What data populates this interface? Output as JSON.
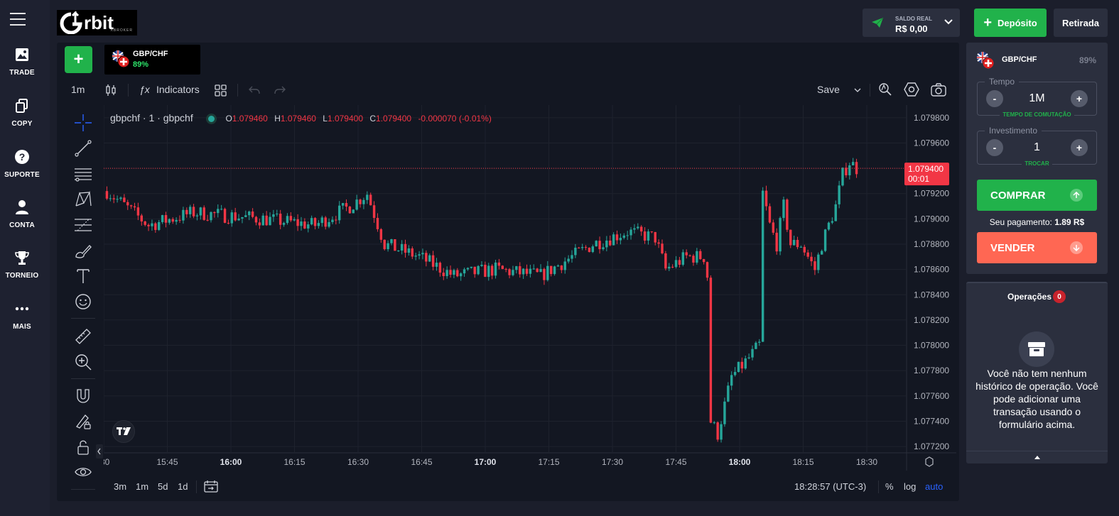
{
  "nav": {
    "items": [
      {
        "label": "TRADE",
        "icon": "image-icon"
      },
      {
        "label": "COPY",
        "icon": "copy-icon"
      },
      {
        "label": "SUPORTE",
        "icon": "help-icon"
      },
      {
        "label": "CONTA",
        "icon": "user-icon"
      },
      {
        "label": "TORNEIO",
        "icon": "trophy-icon"
      },
      {
        "label": "MAIS",
        "icon": "more-icon"
      }
    ]
  },
  "header": {
    "logo_text": "rbit",
    "logo_sub": "XBROKER",
    "balance_label": "SALDO REAL",
    "balance_value": "R$ 0,00",
    "deposit_label": "Depósito",
    "withdraw_label": "Retirada"
  },
  "asset_tab": {
    "name": "GBP/CHF",
    "payout": "89%"
  },
  "toolbar": {
    "interval": "1m",
    "indicators_label": "Indicators",
    "save_label": "Save"
  },
  "legend": {
    "symbol": "gbpchf · 1 · gbpchf",
    "open_label": "O",
    "open": "1.079460",
    "high_label": "H",
    "high": "1.079460",
    "low_label": "L",
    "low": "1.079400",
    "close_label": "C",
    "close": "1.079400",
    "change": "-0.000070 (-0.01%)"
  },
  "chart_data": {
    "type": "candlestick",
    "price_axis": [
      "1.079800",
      "1.079600",
      "1.079400",
      "1.079200",
      "1.079000",
      "1.078800",
      "1.078600",
      "1.078400",
      "1.078200",
      "1.078000",
      "1.077800",
      "1.077600",
      "1.077400",
      "1.077200"
    ],
    "ylim": [
      1.07715,
      1.0799
    ],
    "time_axis": [
      ":30",
      "15:45",
      "16:00",
      "16:15",
      "16:30",
      "16:45",
      "17:00",
      "17:15",
      "17:30",
      "17:45",
      "18:00",
      "18:15",
      "18:30"
    ],
    "bold_times": [
      "16:00",
      "17:00",
      "18:00"
    ],
    "last_price": "1.079400",
    "countdown": "00:01",
    "colors": {
      "up": "#26a69a",
      "down": "#f23645"
    }
  },
  "bottombar": {
    "ranges": [
      "3m",
      "1m",
      "5d",
      "1d"
    ],
    "clock": "18:28:57 (UTC-3)",
    "percent_label": "%",
    "log_label": "log",
    "auto_label": "auto"
  },
  "trade": {
    "asset": "GBP/CHF",
    "payout": "89%",
    "time_label": "Tempo",
    "time_value": "1M",
    "time_hint": "TEMPO DE COMUTAÇÃO",
    "invest_label": "Investimento",
    "invest_value": "1",
    "invest_hint": "TROCAR",
    "minus": "-",
    "plus": "+",
    "buy_label": "COMPRAR",
    "sell_label": "VENDER",
    "payout_label": "Seu pagamento:",
    "payout_value": "1.89 R$"
  },
  "operations": {
    "title": "Operações",
    "count": "0",
    "empty_text": "Você não tem nenhum histórico de operação. Você pode adicionar uma transação usando o formulário acima."
  }
}
